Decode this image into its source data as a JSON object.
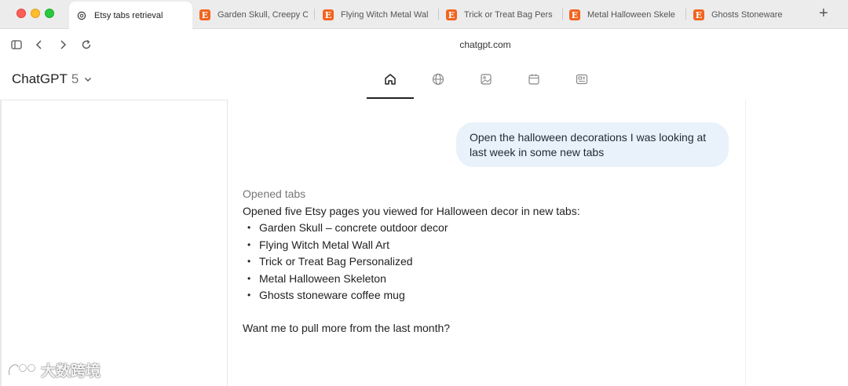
{
  "browser": {
    "tabs": [
      {
        "label": "Etsy tabs retrieval",
        "favicon": "chatgpt-icon",
        "active": true
      },
      {
        "label": "Garden Skull, Creepy C",
        "favicon": "etsy-icon",
        "active": false
      },
      {
        "label": "Flying Witch Metal Wal",
        "favicon": "etsy-icon",
        "active": false
      },
      {
        "label": "Trick or Treat Bag Pers",
        "favicon": "etsy-icon",
        "active": false
      },
      {
        "label": "Metal Halloween Skele",
        "favicon": "etsy-icon",
        "active": false
      },
      {
        "label": "Ghosts Stoneware",
        "favicon": "etsy-icon",
        "active": false
      }
    ],
    "etsy_glyph": "E",
    "new_tab_glyph": "+",
    "url": "chatgpt.com",
    "toolbar_icons": [
      "sidebar-toggle-icon",
      "back-icon",
      "forward-icon",
      "reload-icon"
    ]
  },
  "app": {
    "model_name": "ChatGPT",
    "model_version": "5",
    "nav_icons": [
      "home-icon",
      "globe-icon",
      "image-icon",
      "calendar-icon",
      "news-icon"
    ],
    "active_nav": "home-icon"
  },
  "conversation": {
    "user_message": "Open the halloween decorations I was looking at last week in some new tabs",
    "assistant": {
      "meta": "Opened tabs",
      "intro": "Opened five Etsy pages you viewed for Halloween decor in new tabs:",
      "items": [
        "Garden Skull – concrete outdoor decor",
        "Flying Witch Metal Wall Art",
        "Trick or Treat Bag Personalized",
        "Metal Halloween Skeleton",
        "Ghosts stoneware coffee mug"
      ],
      "followup": "Want me to pull more from the last month?"
    }
  },
  "watermark": {
    "text": "大数跨境"
  },
  "colors": {
    "etsy_orange": "#f1641e",
    "user_bubble": "#e9f1fa",
    "tab_strip": "#ececec"
  }
}
